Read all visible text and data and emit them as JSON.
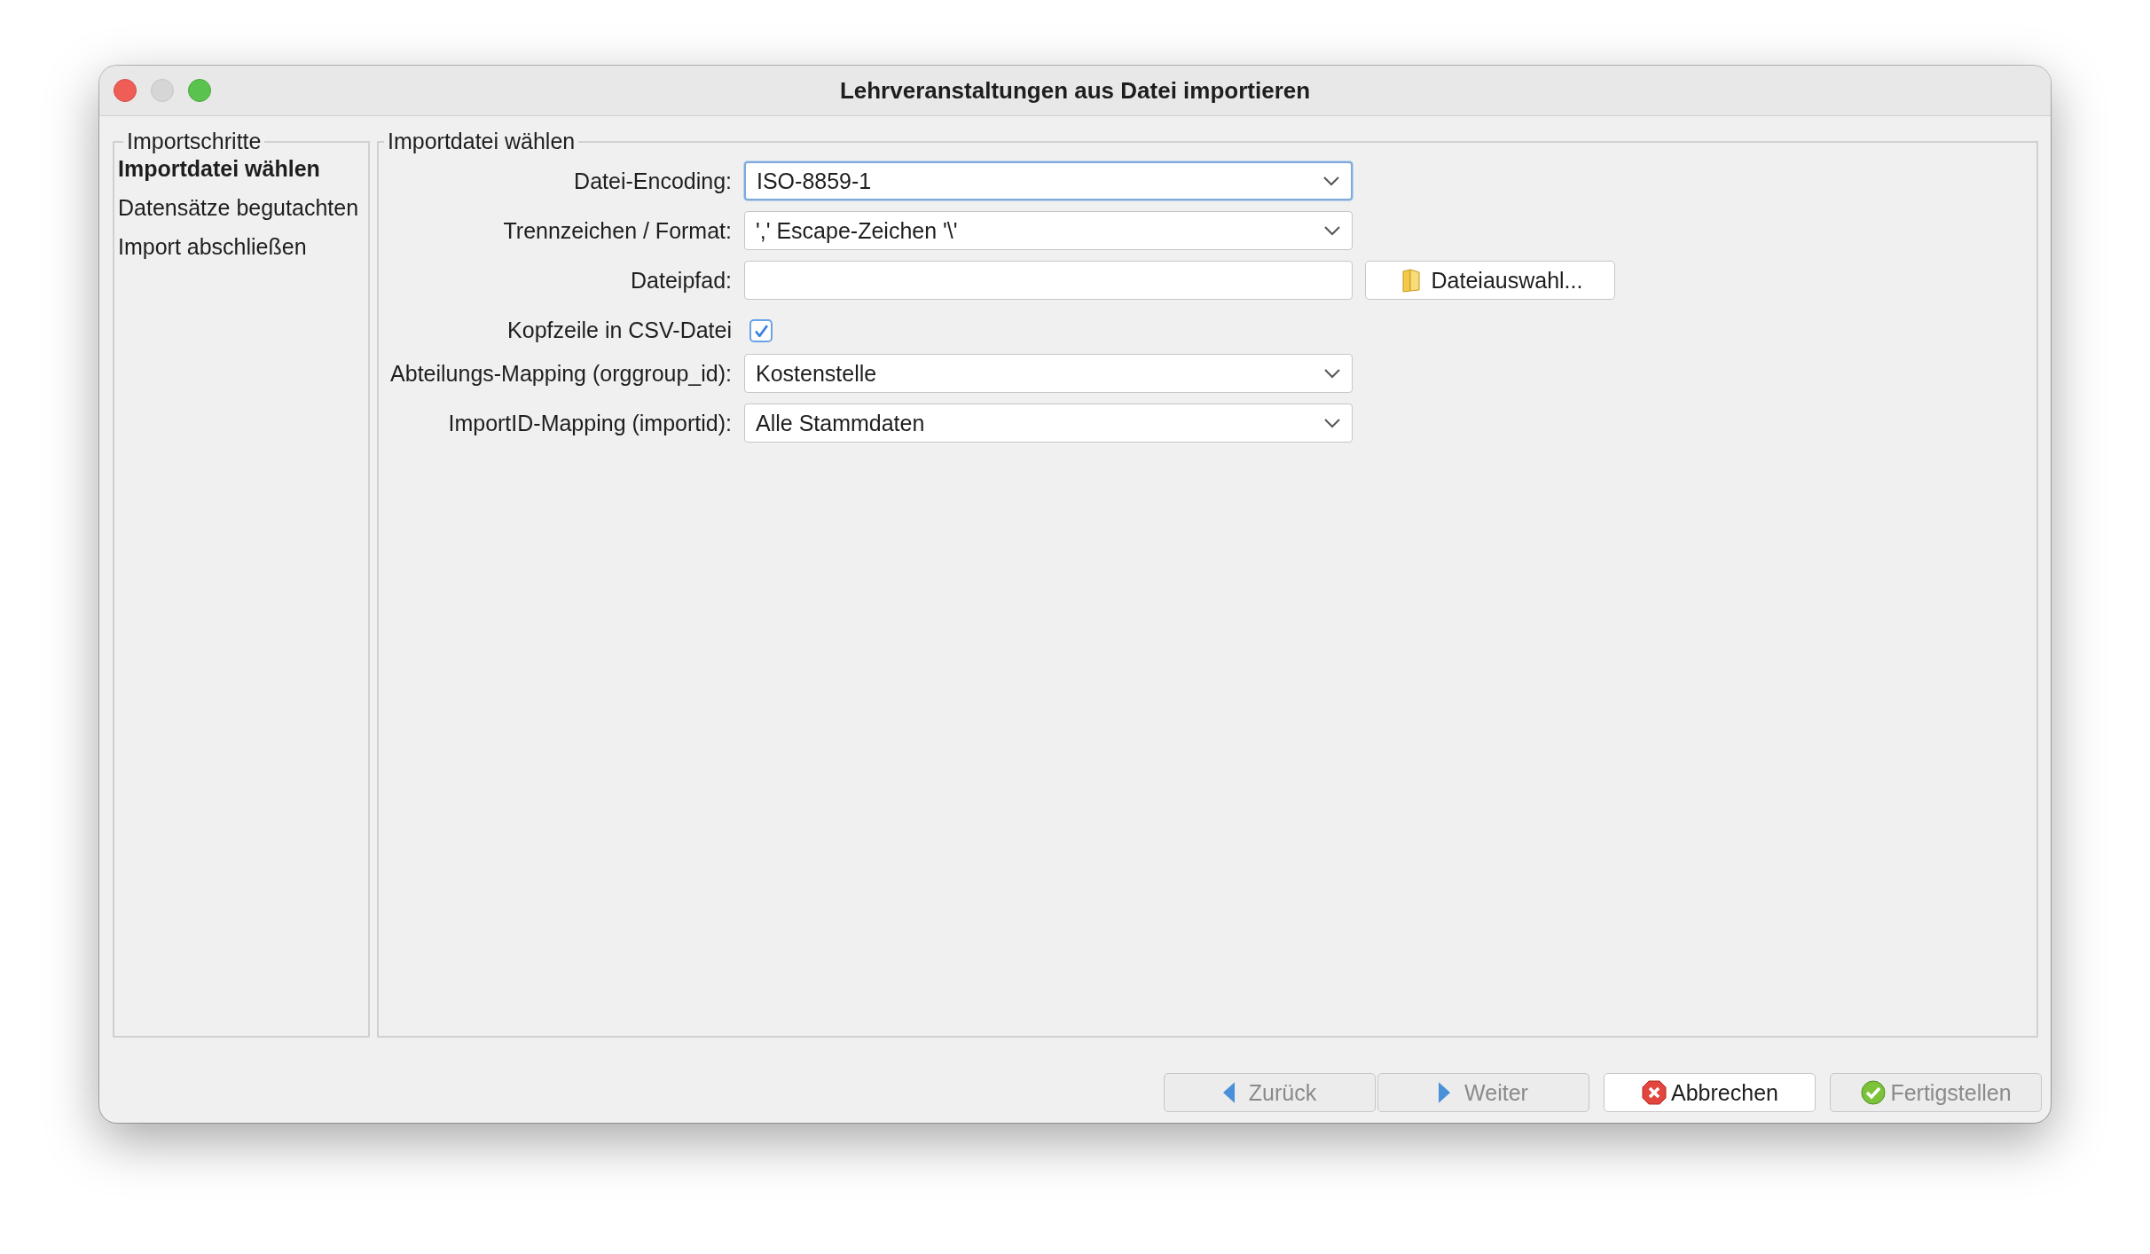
{
  "window": {
    "title": "Lehrveranstaltungen aus Datei importieren"
  },
  "steps": {
    "title": "Importschritte",
    "items": [
      {
        "label": "Importdatei wählen",
        "selected": true
      },
      {
        "label": "Datensätze begutachten",
        "selected": false
      },
      {
        "label": "Import abschließen",
        "selected": false
      }
    ]
  },
  "form": {
    "title": "Importdatei wählen",
    "rows": [
      {
        "kind": "select",
        "label": "Datei-Encoding:",
        "value": "ISO-8859-1",
        "focused": true
      },
      {
        "kind": "select",
        "label": "Trennzeichen / Format:",
        "value": "',' Escape-Zeichen '\\'",
        "focused": false
      },
      {
        "kind": "file",
        "label": "Dateipfad:",
        "button": "Dateiauswahl..."
      },
      {
        "kind": "checkbox",
        "label": "Kopfzeile in CSV-Datei",
        "checked": true
      },
      {
        "kind": "select",
        "label": "Abteilungs-Mapping (orggroup_id):",
        "value": "Kostenstelle",
        "focused": false
      },
      {
        "kind": "select",
        "label": "ImportID-Mapping (importid):",
        "value": "Alle Stammdaten",
        "focused": false
      }
    ]
  },
  "buttons": [
    {
      "label": "Zurück",
      "kind": "back",
      "disabled": true
    },
    {
      "label": "Weiter",
      "kind": "next",
      "disabled": true
    },
    {
      "label": "Abbrechen",
      "kind": "cancel",
      "disabled": false
    },
    {
      "label": "Fertigstellen",
      "kind": "finish",
      "disabled": true
    }
  ]
}
